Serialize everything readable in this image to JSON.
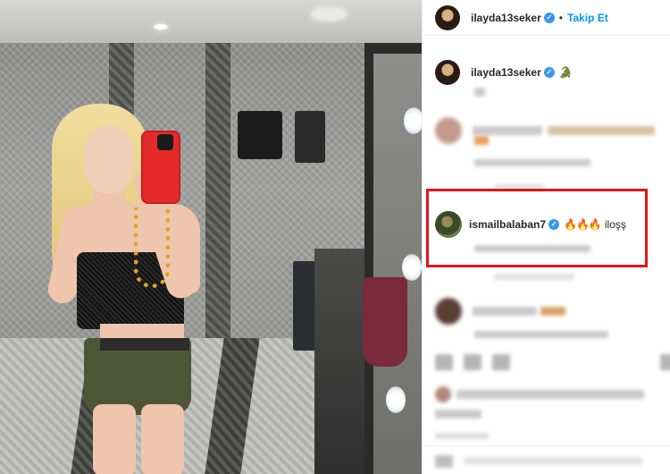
{
  "header": {
    "username": "ilayda13seker",
    "separator": "•",
    "follow_label": "Takip Et",
    "verified_mark": "✓"
  },
  "caption": {
    "username": "ilayda13seker",
    "verified_mark": "✓",
    "emoji": "🐊"
  },
  "highlighted_comment": {
    "username": "ismailbalaban7",
    "verified_mark": "✓",
    "emojis": "🔥🔥🔥",
    "text": "iloşş"
  },
  "colors": {
    "link_blue": "#0095f6",
    "verified_blue": "#3897f0",
    "highlight_red": "#e0161b"
  }
}
